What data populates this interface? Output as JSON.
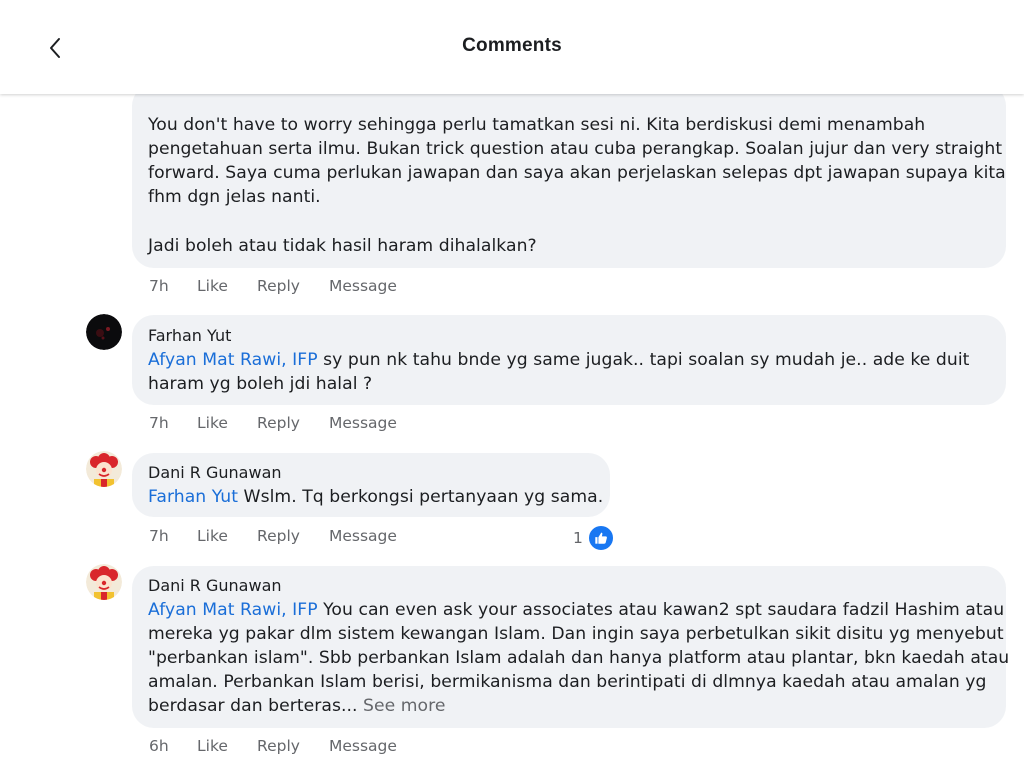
{
  "header": {
    "title": "Comments",
    "back_icon": "chevron-left-icon"
  },
  "actions": {
    "like": "Like",
    "reply": "Reply",
    "message": "Message"
  },
  "comments": [
    {
      "text": [
        "You don't have to worry sehingga perlu tamatkan sesi ni. Kita berdiskusi demi menambah",
        "pengetahuan serta ilmu. Bukan trick question atau cuba perangkap. Soalan jujur dan very straight",
        "forward. Saya cuma perlukan jawapan dan saya akan perjelaskan selepas dpt jawapan supaya kita",
        "fhm dgn jelas nanti.",
        "Jadi boleh atau tidak hasil haram dihalalkan?"
      ],
      "time": "7h"
    },
    {
      "author": "Farhan Yut",
      "mention": "Afyan Mat Rawi, IFP",
      "text": [
        " sy pun nk tahu bnde yg same jugak.. tapi soalan sy mudah je.. ade ke duit",
        "haram yg boleh jdi halal ?"
      ],
      "time": "7h"
    },
    {
      "author": "Dani R Gunawan",
      "mention": "Farhan Yut",
      "text": [
        " Wslm. Tq berkongsi pertanyaan yg sama."
      ],
      "time": "7h",
      "reaction_count": "1"
    },
    {
      "author": "Dani R Gunawan",
      "mention": "Afyan Mat Rawi, IFP",
      "text": [
        " You can even ask your associates atau kawan2 spt saudara fadzil Hashim atau",
        "mereka yg pakar dlm sistem kewangan Islam. Dan ingin saya perbetulkan sikit disitu yg menyebut",
        "\"perbankan islam\". Sbb perbankan Islam adalah dan hanya platform atau plantar, bkn kaedah atau",
        "amalan. Perbankan Islam berisi, bermikanisma dan berintipati di dlmnya kaedah atau amalan yg",
        "berdasar dan berteras..."
      ],
      "see_more": " See more",
      "time": "6h"
    }
  ],
  "colors": {
    "mention": "#1a6ed8",
    "bubble": "#f0f2f5",
    "like_badge": "#1877f2",
    "meta_text": "#65676b"
  }
}
